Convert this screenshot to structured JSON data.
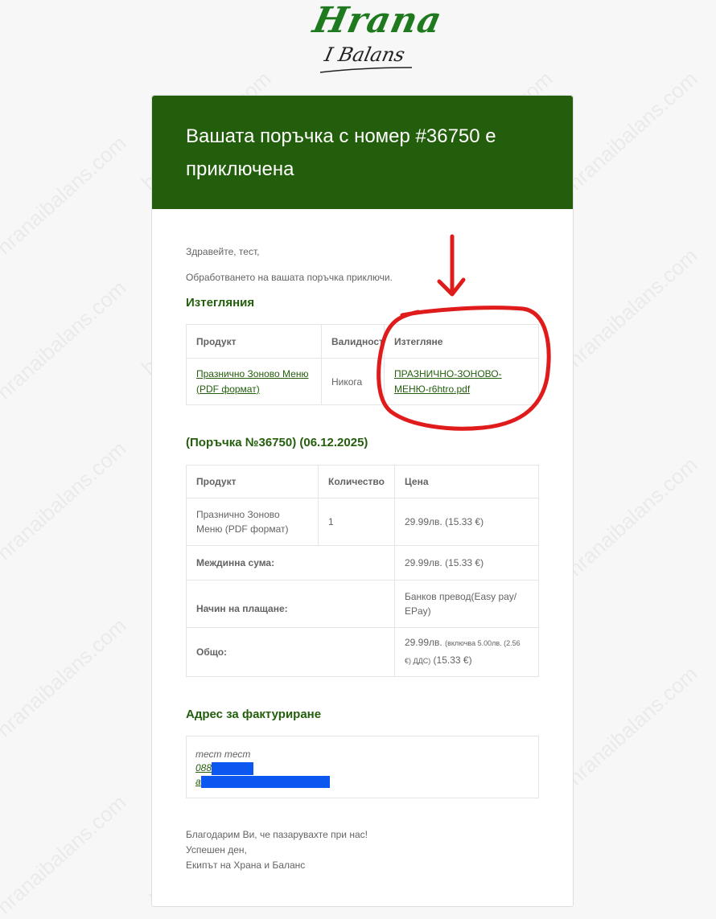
{
  "logo": {
    "top": "Hrana",
    "bottom": "I Balans"
  },
  "header": {
    "title": "Вашата поръчка с номер #36750 е приключена"
  },
  "greeting": "Здравейте, тест,",
  "intro": "Обработването на вашата поръчка приключи.",
  "downloads": {
    "title": "Изтегляния",
    "columns": [
      "Продукт",
      "Валидност",
      "Изтегляне"
    ],
    "rows": [
      {
        "product": "Празнично Зоново Меню (PDF формат)",
        "validity": "Никога",
        "file": "ПРАЗНИЧНО-ЗОНОВО-МЕНЮ-r6htro.pdf"
      }
    ]
  },
  "order": {
    "title": "(Поръчка №36750) (06.12.2025)",
    "columns": [
      "Продукт",
      "Количество",
      "Цена"
    ],
    "items": [
      {
        "product": "Празнично Зоново Меню (PDF формат)",
        "qty": "1",
        "price": "29.99лв. (15.33 €)"
      }
    ],
    "subtotal_label": "Междинна сума:",
    "subtotal_value": "29.99лв. (15.33 €)",
    "payment_label": "Начин на плащане:",
    "payment_value": "Банков превод(Easy pay/ EPay)",
    "total_label": "Общо:",
    "total_main": "29.99лв.",
    "total_tax_note": "(включва 5.00лв. (2.56 €) ДДС)",
    "total_eur": "(15.33 €)"
  },
  "billing": {
    "title": "Адрес за фактуриране",
    "name": "тест тест",
    "phone_visible": "088",
    "email_visible": "a"
  },
  "footer": {
    "line1": "Благодарим Ви, че пазарувахте при нас!",
    "line2": "Успешен ден,",
    "line3": "Екипът на Храна и Баланс"
  },
  "watermark": "hranaibalans.com",
  "colors": {
    "brand_green": "#235e0c",
    "annotation_red": "#e01b1b",
    "redaction_blue": "#0b57f0"
  }
}
